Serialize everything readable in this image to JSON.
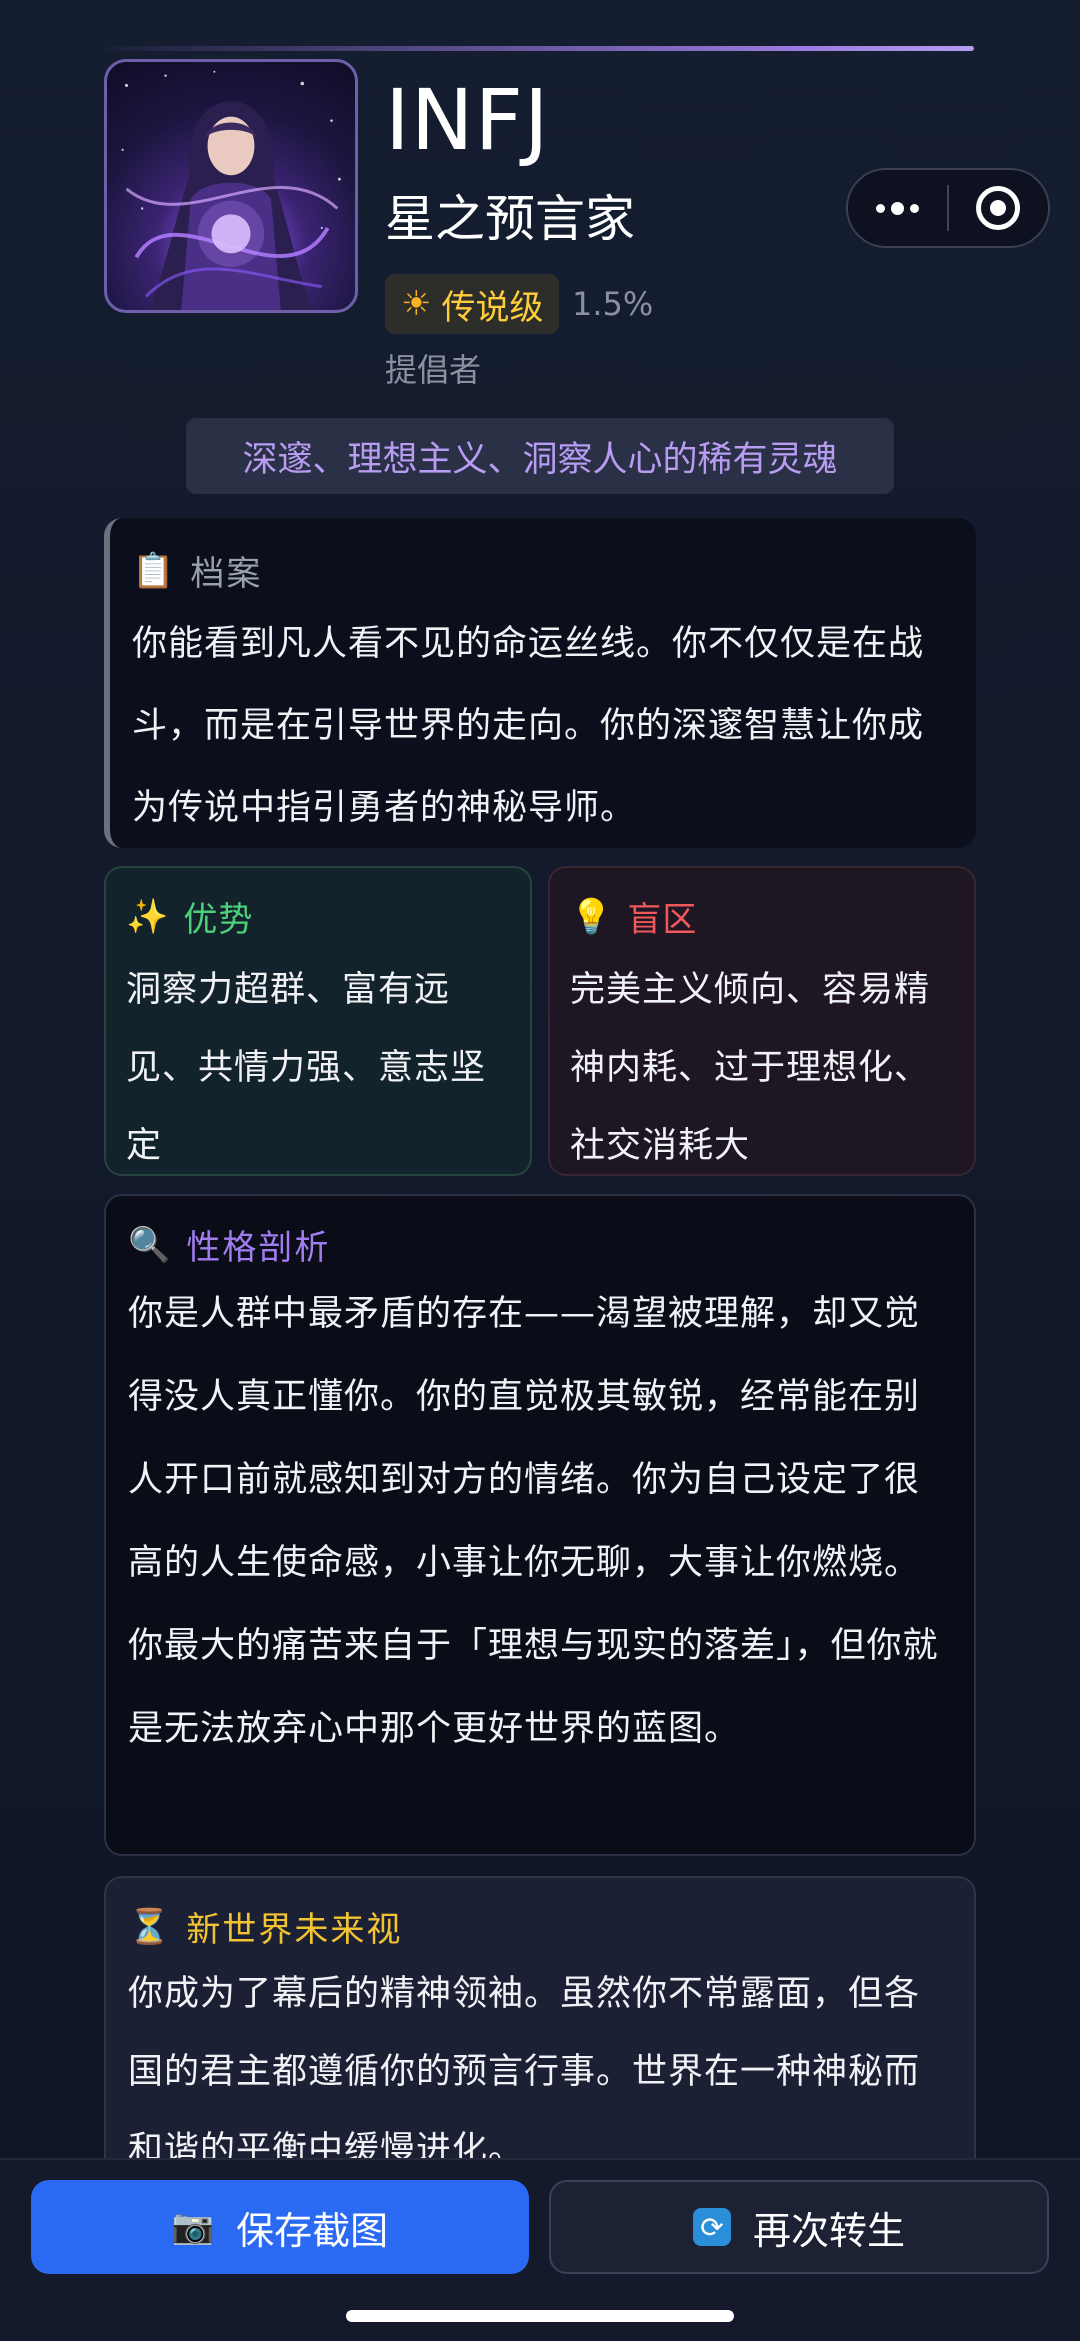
{
  "header": {
    "type_code": "INFJ",
    "type_name": "星之预言家",
    "rarity_label": "传说级",
    "rarity_pct": "1.5%",
    "role": "提倡者",
    "tagline": "深邃、理想主义、洞察人心的稀有灵魂",
    "avatar_icon": "sorceress-portrait",
    "capsule_icons": [
      "more-dots-icon",
      "target-close-icon"
    ]
  },
  "profile": {
    "icon": "clipboard-icon",
    "title": "档案",
    "body": "你能看到凡人看不见的命运丝线。你不仅仅是在战斗，而是在引导世界的走向。你的深邃智慧让你成为传说中指引勇者的神秘导师。"
  },
  "strengths": {
    "icon": "sparkles-icon",
    "title": "优势",
    "body": "洞察力超群、富有远见、共情力强、意志坚定"
  },
  "blind_spots": {
    "icon": "lightbulb-icon",
    "title": "盲区",
    "body": "完美主义倾向、容易精神内耗、过于理想化、社交消耗大"
  },
  "analysis": {
    "icon": "magnifier-icon",
    "title": "性格剖析",
    "body": "你是人群中最矛盾的存在——渴望被理解，却又觉得没人真正懂你。你的直觉极其敏锐，经常能在别人开口前就感知到对方的情绪。你为自己设定了很高的人生使命感，小事让你无聊，大事让你燃烧。你最大的痛苦来自于「理想与现实的落差」，但你就是无法放弃心中那个更好世界的蓝图。"
  },
  "future": {
    "icon": "hourglass-icon",
    "title": "新世界未来视",
    "body": "你成为了幕后的精神领袖。虽然你不常露面，但各国的君主都遵循你的预言行事。世界在一种神秘而和谐的平衡中缓慢进化。"
  },
  "actions": {
    "save_label": "保存截图",
    "save_icon": "camera-icon",
    "retry_label": "再次转生",
    "retry_icon": "refresh-icon"
  },
  "colors": {
    "accent_purple": "#a27df0",
    "legend_gold": "#ffcc3a",
    "strength_green": "#4cd17a",
    "blind_red": "#f0585c",
    "future_gold": "#f3c431",
    "primary_blue": "#2a6af2"
  }
}
